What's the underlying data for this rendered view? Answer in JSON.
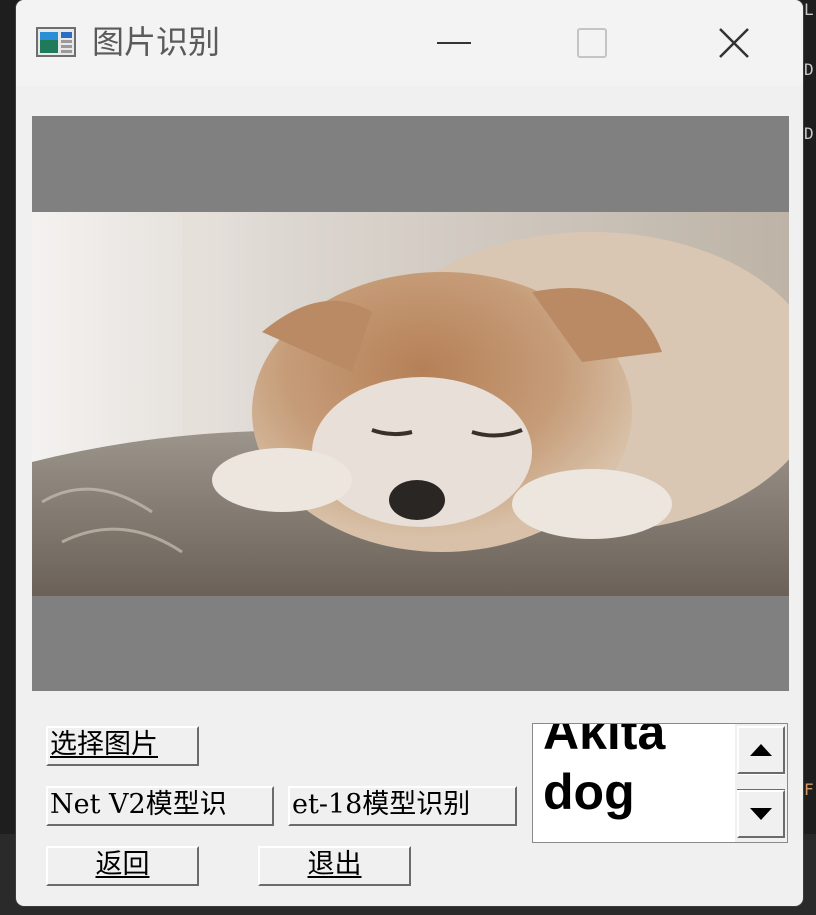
{
  "window": {
    "title": "图片识别",
    "icon": "app-window-icon",
    "controls": [
      "minimize-icon",
      "maximize-icon",
      "close-icon"
    ]
  },
  "image_panel": {
    "photo_description_icon": "photo-akita-dog",
    "letterbox_color": "#808080"
  },
  "buttons": {
    "select_image": "选择图片",
    "mobilenet": "Net V2模型识",
    "resnet": "et-18模型识别",
    "back": "返回",
    "exit": "退出"
  },
  "result": {
    "lines": [
      "Akita",
      "dog"
    ]
  },
  "scroll": {
    "up_icon": "scroll-up-arrow-icon",
    "down_icon": "scroll-down-arrow-icon"
  },
  "background": {
    "chars": [
      "L",
      "D",
      "D",
      "F"
    ]
  }
}
